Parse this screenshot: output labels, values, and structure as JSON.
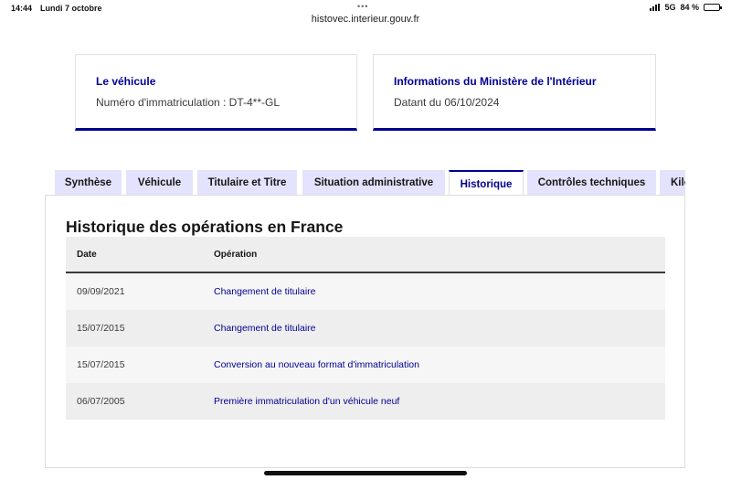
{
  "status_bar": {
    "time": "14:44",
    "date": "Lundi 7 octobre",
    "dots": "•••",
    "network": "5G",
    "battery": "84 %",
    "battery_level": 0.84
  },
  "browser": {
    "url": "histovec.interieur.gouv.fr"
  },
  "vehicle_card": {
    "title": "Le véhicule",
    "text": "Numéro d'immatriculation : DT-4**-GL"
  },
  "ministry_card": {
    "title": "Informations du Ministère de l'Intérieur",
    "text": "Datant du 06/10/2024"
  },
  "tabs": [
    {
      "label": "Synthèse"
    },
    {
      "label": "Véhicule"
    },
    {
      "label": "Titulaire et Titre"
    },
    {
      "label": "Situation administrative"
    },
    {
      "label": "Historique"
    },
    {
      "label": "Contrôles techniques"
    },
    {
      "label": "Kilométrage"
    }
  ],
  "active_tab": "Historique",
  "history": {
    "title": "Historique des opérations en France",
    "columns": {
      "date": "Date",
      "operation": "Opération"
    },
    "rows": [
      {
        "date": "09/09/2021",
        "operation": "Changement de titulaire"
      },
      {
        "date": "15/07/2015",
        "operation": "Changement de titulaire"
      },
      {
        "date": "15/07/2015",
        "operation": "Conversion au nouveau format d'immatriculation"
      },
      {
        "date": "06/07/2005",
        "operation": "Première immatriculation d'un véhicule neuf"
      }
    ]
  },
  "colors": {
    "accent": "#000091",
    "tab_background": "#e3e3fd"
  }
}
